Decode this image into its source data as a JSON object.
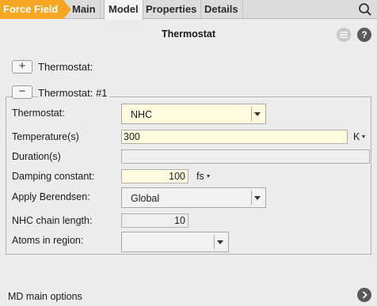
{
  "tabs": {
    "breadcrumb": "Force Field",
    "items": [
      "Main",
      "Model",
      "Properties",
      "Details"
    ],
    "active": "Model"
  },
  "page": {
    "title": "Thermostat",
    "help_label": "?"
  },
  "collapsed_section": {
    "toggle": "+",
    "label": "Thermostat:"
  },
  "expanded_section": {
    "toggle": "−",
    "label": "Thermostat: #1"
  },
  "form": {
    "thermostat": {
      "label": "Thermostat:",
      "value": "NHC"
    },
    "temperature": {
      "label": "Temperature(s)",
      "value": "300",
      "unit": "K"
    },
    "duration": {
      "label": "Duration(s)",
      "value": ""
    },
    "damping": {
      "label": "Damping constant:",
      "value": "100",
      "unit": "fs"
    },
    "berendsen": {
      "label": "Apply Berendsen:",
      "value": "Global"
    },
    "nhc_chain": {
      "label": "NHC chain length:",
      "value": "10"
    },
    "atoms_region": {
      "label": "Atoms in region:",
      "value": ""
    }
  },
  "footer": {
    "label": "MD main options"
  },
  "colors": {
    "accent": "#f5a623",
    "field_highlight": "#fffce0"
  }
}
